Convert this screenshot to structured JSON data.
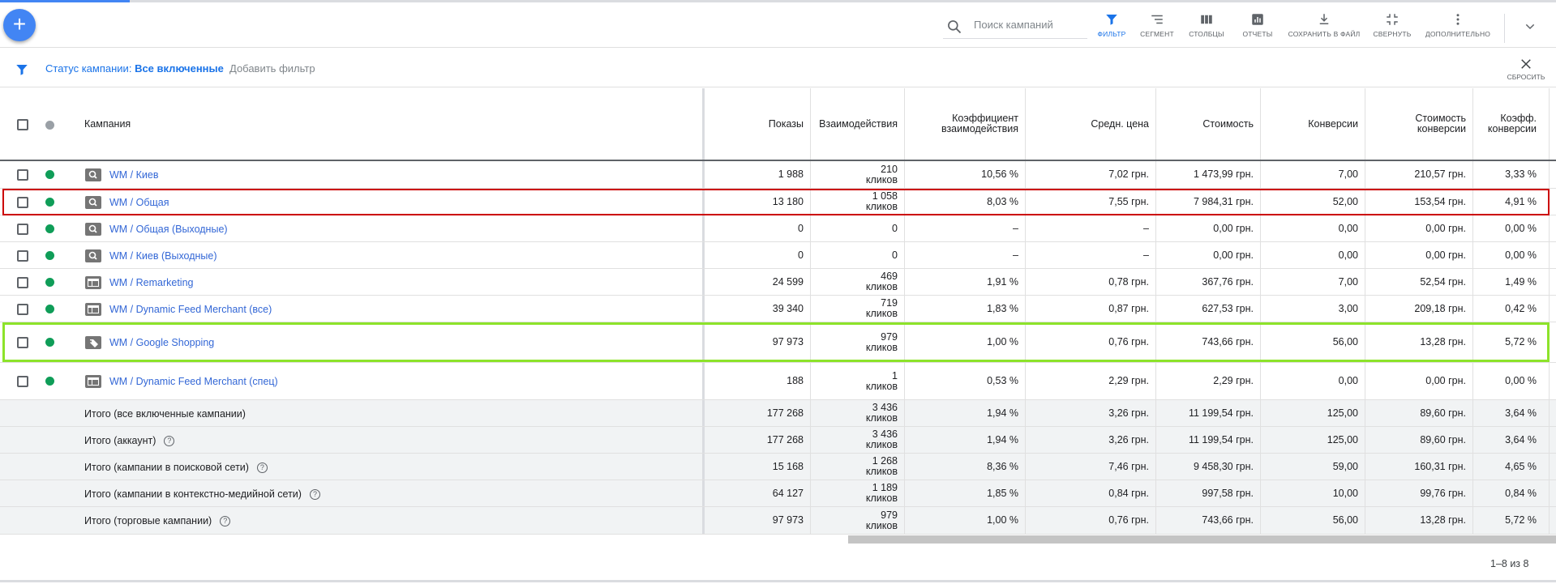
{
  "toolbar": {
    "search_placeholder": "Поиск кампаний",
    "buttons": [
      {
        "label": "ФИЛЬТР",
        "icon": "filter-icon",
        "active": true
      },
      {
        "label": "СЕГМЕНТ",
        "icon": "segment-icon"
      },
      {
        "label": "СТОЛБЦЫ",
        "icon": "columns-icon"
      },
      {
        "label": "ОТЧЕТЫ",
        "icon": "reports-icon"
      },
      {
        "label": "СОХРАНИТЬ В ФАЙЛ",
        "icon": "download-icon"
      },
      {
        "label": "СВЕРНУТЬ",
        "icon": "collapse-icon"
      },
      {
        "label": "ДОПОЛНИТЕЛЬНО",
        "icon": "more-vert-icon"
      }
    ],
    "fab": "+"
  },
  "filter": {
    "status_label": "Статус кампании:",
    "status_value": "Все включенные",
    "add_filter": "Добавить фильтр",
    "reset": "СБРОСИТЬ"
  },
  "table": {
    "headers": {
      "campaign": "Кампания",
      "impressions": "Показы",
      "interactions": "Взаимодействия",
      "interaction_rate_1": "Коэффициент",
      "interaction_rate_2": "взаимодействия",
      "avg_cost": "Средн. цена",
      "cost": "Стоимость",
      "conversions": "Конверсии",
      "cost_conv_1": "Стоимость",
      "cost_conv_2": "конверсии",
      "conv_rate_1": "Коэфф.",
      "conv_rate_2": "конверсии"
    },
    "rows": [
      {
        "type": "search",
        "name": "WM / Киев",
        "impr": "1 988",
        "inter_n": "210",
        "inter_u": "кликов",
        "rate": "10,56 %",
        "avg": "7,02 грн.",
        "cost": "1 473,99 грн.",
        "conv": "7,00",
        "cpc": "210,57 грн.",
        "cr": "3,33 %"
      },
      {
        "type": "search",
        "name": "WM / Общая",
        "impr": "13 180",
        "inter_n": "1 058",
        "inter_u": "кликов",
        "rate": "8,03 %",
        "avg": "7,55 грн.",
        "cost": "7 984,31 грн.",
        "conv": "52,00",
        "cpc": "153,54 грн.",
        "cr": "4,91 %"
      },
      {
        "type": "search",
        "name": "WM / Общая (Выходные)",
        "impr": "0",
        "inter_n": "0",
        "inter_u": "",
        "rate": "–",
        "avg": "–",
        "cost": "0,00 грн.",
        "conv": "0,00",
        "cpc": "0,00 грн.",
        "cr": "0,00 %"
      },
      {
        "type": "search",
        "name": "WM / Киев (Выходные)",
        "impr": "0",
        "inter_n": "0",
        "inter_u": "",
        "rate": "–",
        "avg": "–",
        "cost": "0,00 грн.",
        "conv": "0,00",
        "cpc": "0,00 грн.",
        "cr": "0,00 %"
      },
      {
        "type": "display",
        "name": "WM / Remarketing",
        "impr": "24 599",
        "inter_n": "469",
        "inter_u": "кликов",
        "rate": "1,91 %",
        "avg": "0,78 грн.",
        "cost": "367,76 грн.",
        "conv": "7,00",
        "cpc": "52,54 грн.",
        "cr": "1,49 %"
      },
      {
        "type": "display",
        "name": "WM / Dynamic Feed Merchant (все)",
        "impr": "39 340",
        "inter_n": "719",
        "inter_u": "кликов",
        "rate": "1,83 %",
        "avg": "0,87 грн.",
        "cost": "627,53 грн.",
        "conv": "3,00",
        "cpc": "209,18 грн.",
        "cr": "0,42 %"
      },
      {
        "type": "shopping",
        "name": "WM / Google Shopping",
        "impr": "97 973",
        "inter_n": "979",
        "inter_u": "кликов",
        "rate": "1,00 %",
        "avg": "0,76 грн.",
        "cost": "743,66 грн.",
        "conv": "56,00",
        "cpc": "13,28 грн.",
        "cr": "5,72 %"
      },
      {
        "type": "display",
        "name": "WM / Dynamic Feed Merchant (спец)",
        "impr": "188",
        "inter_n": "1",
        "inter_u": "кликов",
        "rate": "0,53 %",
        "avg": "2,29 грн.",
        "cost": "2,29 грн.",
        "conv": "0,00",
        "cpc": "0,00 грн.",
        "cr": "0,00 %"
      }
    ],
    "totals": [
      {
        "name": "Итого (все включенные кампании)",
        "help": false,
        "impr": "177 268",
        "inter_n": "3 436",
        "inter_u": "кликов",
        "rate": "1,94 %",
        "avg": "3,26 грн.",
        "cost": "11 199,54 грн.",
        "conv": "125,00",
        "cpc": "89,60 грн.",
        "cr": "3,64 %"
      },
      {
        "name": "Итого (аккаунт)",
        "help": true,
        "impr": "177 268",
        "inter_n": "3 436",
        "inter_u": "кликов",
        "rate": "1,94 %",
        "avg": "3,26 грн.",
        "cost": "11 199,54 грн.",
        "conv": "125,00",
        "cpc": "89,60 грн.",
        "cr": "3,64 %"
      },
      {
        "name": "Итого (кампании в поисковой сети)",
        "help": true,
        "impr": "15 168",
        "inter_n": "1 268",
        "inter_u": "кликов",
        "rate": "8,36 %",
        "avg": "7,46 грн.",
        "cost": "9 458,30 грн.",
        "conv": "59,00",
        "cpc": "160,31 грн.",
        "cr": "4,65 %"
      },
      {
        "name": "Итого (кампании в контекстно-медийной сети)",
        "help": true,
        "impr": "64 127",
        "inter_n": "1 189",
        "inter_u": "кликов",
        "rate": "1,85 %",
        "avg": "0,84 грн.",
        "cost": "997,58 грн.",
        "conv": "10,00",
        "cpc": "99,76 грн.",
        "cr": "0,84 %"
      },
      {
        "name": "Итого (торговые кампании)",
        "help": true,
        "impr": "97 973",
        "inter_n": "979",
        "inter_u": "кликов",
        "rate": "1,00 %",
        "avg": "0,76 грн.",
        "cost": "743,66 грн.",
        "conv": "56,00",
        "cpc": "13,28 грн.",
        "cr": "5,72 %"
      }
    ]
  },
  "pagination": "1–8 из 8",
  "colors": {
    "accent": "#1a73e8",
    "status_enabled": "#0f9d58",
    "highlight_red": "#cc0000",
    "highlight_green": "#8de32a"
  }
}
